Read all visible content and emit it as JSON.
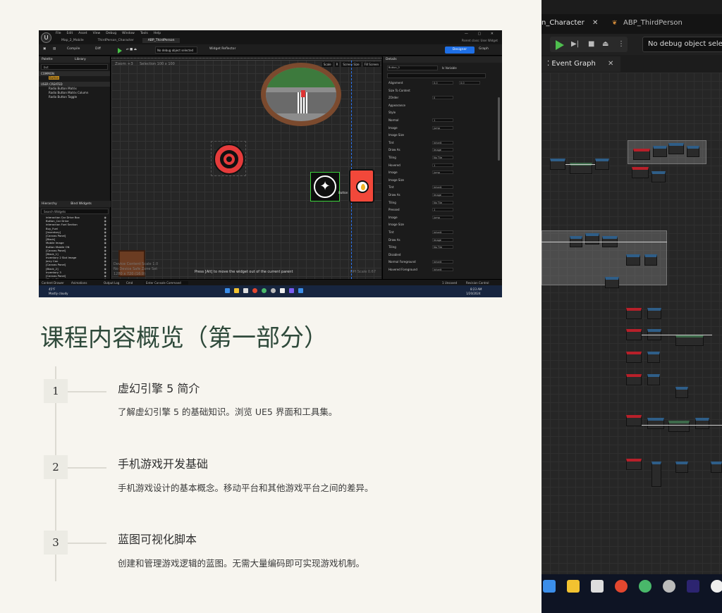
{
  "slide": {
    "title": "课程内容概览（第一部分）",
    "sections": [
      {
        "number": "1",
        "title": "虚幻引擎 5 简介",
        "description": "了解虚幻引擎 5 的基础知识。浏览 UE5 界面和工具集。"
      },
      {
        "number": "2",
        "title": "手机游戏开发基础",
        "description": "手机游戏设计的基本概念。移动平台和其他游戏平台之间的差异。"
      },
      {
        "number": "3",
        "title": "蓝图可视化脚本",
        "description": "创建和管理游戏逻辑的蓝图。无需大量编码即可实现游戏机制。"
      }
    ]
  },
  "left_screenshot": {
    "menu": [
      "File",
      "Edit",
      "Asset",
      "View",
      "Debug",
      "Window",
      "Tools",
      "Help"
    ],
    "tabs": [
      "Map_2_Mobile",
      "ThirdPerson_Character",
      "ABP_ThirdPerson"
    ],
    "window_controls": "— ▢ ✕",
    "parent_class": "Parent class: User Widget",
    "toolbar": {
      "compile": "Compile",
      "diff": "Diff",
      "debug_select": "No debug object selected",
      "widget_reflector": "Widget Reflector",
      "designer": "Designer",
      "graph": "Graph"
    },
    "palette": {
      "title": "Palette",
      "library": "Library",
      "search": "but",
      "sections": [
        "COMMON",
        "USER CREATED"
      ],
      "common_items": [
        "Button"
      ],
      "user_items": [
        "Radio Button Matrix",
        "Radio Button Matrix Column",
        "Radio Button Toggle"
      ],
      "highlight": "Button"
    },
    "hierarchy": {
      "title": "Hierarchy",
      "bind_widgets": "Bind Widgets",
      "search": "Search Widgets",
      "items": [
        "interaction Car Drive Box",
        "Button_Car Drive",
        "interaction Fuel Section",
        "Buy_Fuel",
        "[Inventory]",
        "[Canvas Panel]",
        "[Black]",
        "Mobile Image",
        "Button Mobile ON",
        "[Canvas Panel]",
        "[Black_1]",
        "Inventory 2 Slot Image",
        "Jerry Can",
        "[Canvas Panel]",
        "[Black_2]",
        "Inventory 3",
        "[Canvas Panel]",
        "[Black_3]",
        "Inventory 4",
        "[Messenger] ^",
        "Setting",
        "[FPS Counter] \"FPS: 60\"",
        "Button_WalkRun"
      ]
    },
    "canvas": {
      "zoom": "Zoom +3",
      "selection": "Selection 100 x 100",
      "tools": [
        "Scale",
        "R",
        "Screen Size",
        "Fill Screen"
      ],
      "button_label": "Button",
      "footer_lines": [
        "Device Content Scale 1.0",
        "No Device Safe Zone Set",
        "1280 x 720 (16:9)"
      ],
      "hint": "Press [Alt] to move the widget out of the current parent",
      "dpi": "DPI Scale 0.67"
    },
    "details": {
      "title": "Details",
      "name": "Button_0",
      "is_variable": "Is Variable",
      "rows": [
        {
          "label": "Alignment",
          "value": "0.0",
          "value2": "0.0"
        },
        {
          "label": "Size To Content",
          "value": ""
        },
        {
          "label": "ZOrder",
          "value": "0"
        },
        {
          "label": "Appearance",
          "value": ""
        },
        {
          "label": "Style",
          "value": ""
        },
        {
          "label": "Normal",
          "value": "1"
        },
        {
          "label": "Image",
          "value": "jump"
        },
        {
          "label": "Image Size",
          "value": ""
        },
        {
          "label": "Tint",
          "value": "Inherit"
        },
        {
          "label": "Draw As",
          "value": "Image"
        },
        {
          "label": "Tiling",
          "value": "No Tile"
        },
        {
          "label": "Hovered",
          "value": "1"
        },
        {
          "label": "Image",
          "value": "jump"
        },
        {
          "label": "Image Size",
          "value": ""
        },
        {
          "label": "Tint",
          "value": "Inherit"
        },
        {
          "label": "Draw As",
          "value": "Image"
        },
        {
          "label": "Tiling",
          "value": "No Tile"
        },
        {
          "label": "Pressed",
          "value": "1"
        },
        {
          "label": "Image",
          "value": "jump"
        },
        {
          "label": "Image Size",
          "value": ""
        },
        {
          "label": "Tint",
          "value": "Inherit"
        },
        {
          "label": "Draw As",
          "value": "Image"
        },
        {
          "label": "Tiling",
          "value": "No Tile"
        },
        {
          "label": "Disabled",
          "value": ""
        },
        {
          "label": "Normal Foreground",
          "value": "Inherit"
        },
        {
          "label": "Hovered Foreground",
          "value": "Inherit"
        }
      ]
    },
    "statusbar": [
      "Content Drawer",
      "Animations",
      "Output Log",
      "Cmd",
      "Enter Console Command",
      "1 Unsaved",
      "Revision Control"
    ],
    "taskbar": {
      "weather": "45°F",
      "weather_desc": "Mostly cloudy",
      "time": "8:23 AM",
      "date": "1/20/2024"
    }
  },
  "right_screenshot": {
    "tab1": "n_Character",
    "tab2": "ABP_ThirdPerson",
    "debug_select": "No debug object select",
    "event_graph": "Event Graph"
  },
  "colors": {
    "title": "#2f4a3b",
    "accent_blue": "#1e6fe6",
    "play_green": "#47c247",
    "wheel_red": "#e53b3b"
  }
}
